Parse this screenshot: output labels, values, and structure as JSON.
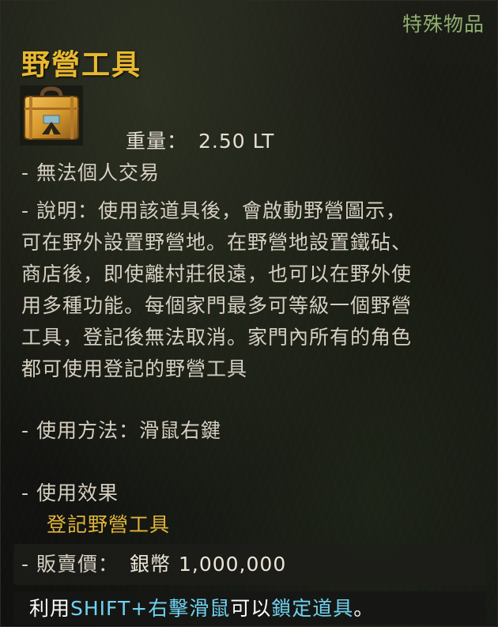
{
  "tooltip": {
    "category": "特殊物品",
    "item_name": "野營工具",
    "icon": "camping-toolbox-icon",
    "weight_label": "重量：",
    "weight_value": "2.50 LT",
    "trade": "- 無法個人交易",
    "description_lines": [
      "- 說明：使用該道具後，會啟動野營圖示，",
      "可在野外設置野營地。在野營地設置鐵砧、",
      "商店後，即使離村莊很遠，也可以在野外使",
      "用多種功能。每個家門最多可等級一個野營",
      "工具，登記後無法取消。家門內所有的角色",
      "都可使用登記的野營工具"
    ],
    "usage": "- 使用方法：滑鼠右鍵",
    "effect_label": "- 使用效果",
    "effect_value": "登記野營工具",
    "price_label": "- 販賣價：",
    "price_currency": "銀幣",
    "price_amount": "1,000,000",
    "hint_prefix": "利用",
    "hint_key": "SHIFT+右擊滑鼠",
    "hint_middle": "可以",
    "hint_action": "鎖定道具",
    "hint_suffix": "。"
  },
  "colors": {
    "item_name": "#e8b830",
    "category": "#8fae6f",
    "highlight": "#6fd3f0",
    "effect": "#e2b53a"
  }
}
